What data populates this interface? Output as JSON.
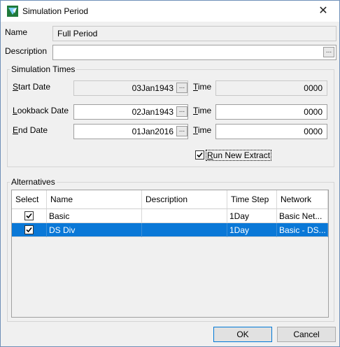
{
  "window": {
    "title": "Simulation Period",
    "close_glyph": "✕"
  },
  "name": {
    "label": "Name",
    "value": "Full Period"
  },
  "description": {
    "label": "Description",
    "value": "",
    "button": "..."
  },
  "sim_times": {
    "group_title": "Simulation Times",
    "start": {
      "label_u": "S",
      "label_rest": "tart Date",
      "date": "03Jan1943",
      "time_label_u": "T",
      "time_label_rest": "ime",
      "time": "0000"
    },
    "lookback": {
      "label_u": "L",
      "label_rest": "ookback Date",
      "date": "02Jan1943",
      "time_label_u": "T",
      "time_label_rest": "ime",
      "time": "0000"
    },
    "end": {
      "label_u": "E",
      "label_rest": "nd Date",
      "date": "01Jan2016",
      "time_label_u": "T",
      "time_label_rest": "ime",
      "time": "0000"
    },
    "run_new_extract": {
      "label_u": "R",
      "label_rest": "un New Extract",
      "checked": true
    }
  },
  "alternatives": {
    "group_title": "Alternatives",
    "columns": [
      "Select",
      "Name",
      "Description",
      "Time Step",
      "Network"
    ],
    "rows": [
      {
        "select": true,
        "name": "Basic",
        "description": "",
        "time_step": "1Day",
        "network": "Basic Net...",
        "selected": false
      },
      {
        "select": true,
        "name": "DS Div",
        "description": "",
        "time_step": "1Day",
        "network": "Basic - DS...",
        "selected": true
      }
    ]
  },
  "buttons": {
    "ok": "OK",
    "cancel": "Cancel"
  },
  "colors": {
    "selection": "#0a78d7",
    "default_button_border": "#0078d7"
  }
}
